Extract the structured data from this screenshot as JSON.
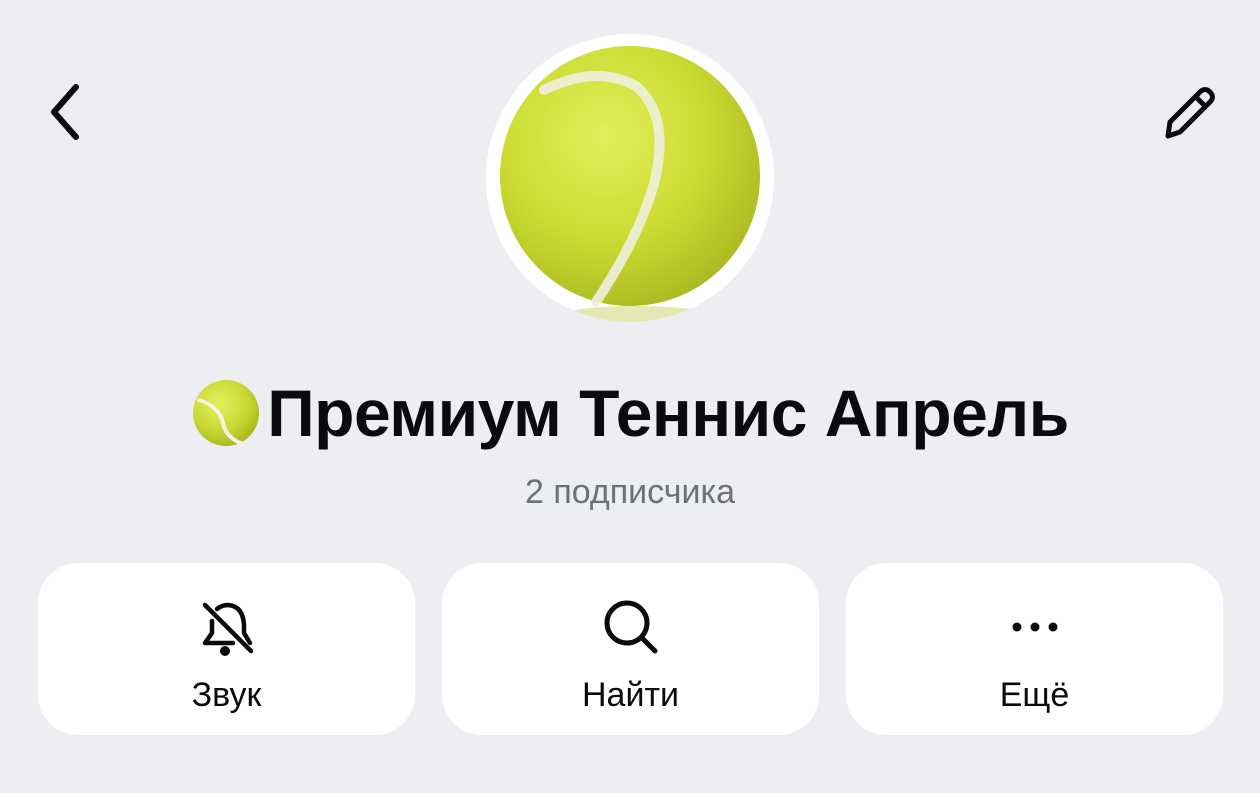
{
  "channel": {
    "title": "Премиум Теннис Апрель",
    "subtitle": "2 подписчика",
    "avatar_icon": "tennis-ball",
    "title_emoji": "tennis-ball-emoji"
  },
  "header": {
    "back_icon": "chevron-left-icon",
    "edit_icon": "pencil-icon"
  },
  "actions": [
    {
      "label": "Звук",
      "icon": "bell-slash-icon"
    },
    {
      "label": "Найти",
      "icon": "search-icon"
    },
    {
      "label": "Ещё",
      "icon": "more-dots-icon"
    }
  ],
  "colors": {
    "background": "#ECEEF2",
    "card": "#FFFFFF",
    "text": "#0B0B0D",
    "secondary_text": "#6E7079",
    "ball": "#D2E03A"
  }
}
